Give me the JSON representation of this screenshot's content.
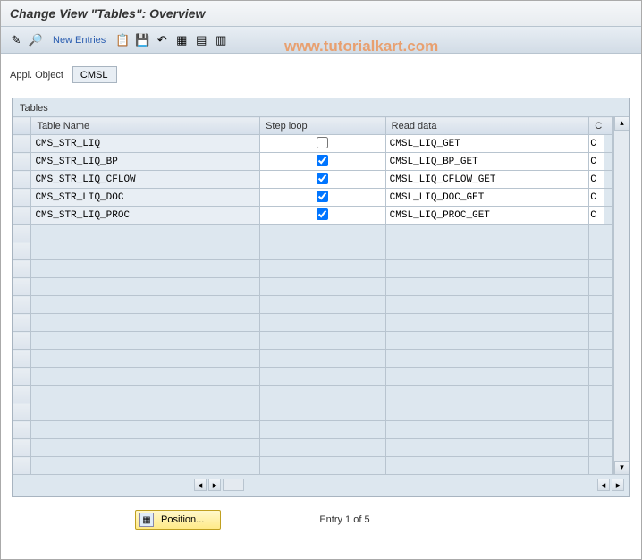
{
  "title": "Change View \"Tables\": Overview",
  "toolbar": {
    "new_entries": "New Entries"
  },
  "watermark": "www.tutorialkart.com",
  "filter": {
    "label": "Appl. Object",
    "value": "CMSL"
  },
  "grid": {
    "title": "Tables",
    "columns": {
      "tableName": "Table Name",
      "stepLoop": "Step loop",
      "readData": "Read data",
      "c": "C"
    },
    "rows": [
      {
        "tableName": "CMS_STR_LIQ",
        "stepLoop": false,
        "readData": "CMSL_LIQ_GET",
        "c": "C"
      },
      {
        "tableName": "CMS_STR_LIQ_BP",
        "stepLoop": true,
        "readData": "CMSL_LIQ_BP_GET",
        "c": "C"
      },
      {
        "tableName": "CMS_STR_LIQ_CFLOW",
        "stepLoop": true,
        "readData": "CMSL_LIQ_CFLOW_GET",
        "c": "C"
      },
      {
        "tableName": "CMS_STR_LIQ_DOC",
        "stepLoop": true,
        "readData": "CMSL_LIQ_DOC_GET",
        "c": "C"
      },
      {
        "tableName": "CMS_STR_LIQ_PROC",
        "stepLoop": true,
        "readData": "CMSL_LIQ_PROC_GET",
        "c": "C"
      }
    ],
    "empty_rows": 14
  },
  "footer": {
    "position_label": "Position...",
    "entry_text": "Entry 1 of 5"
  },
  "icons": {
    "pencil": "✎",
    "toggle": "🔎",
    "copy": "📋",
    "save": "💾",
    "undo": "↶",
    "selectall": "▦",
    "selectblock": "▤",
    "deselect": "▥"
  }
}
